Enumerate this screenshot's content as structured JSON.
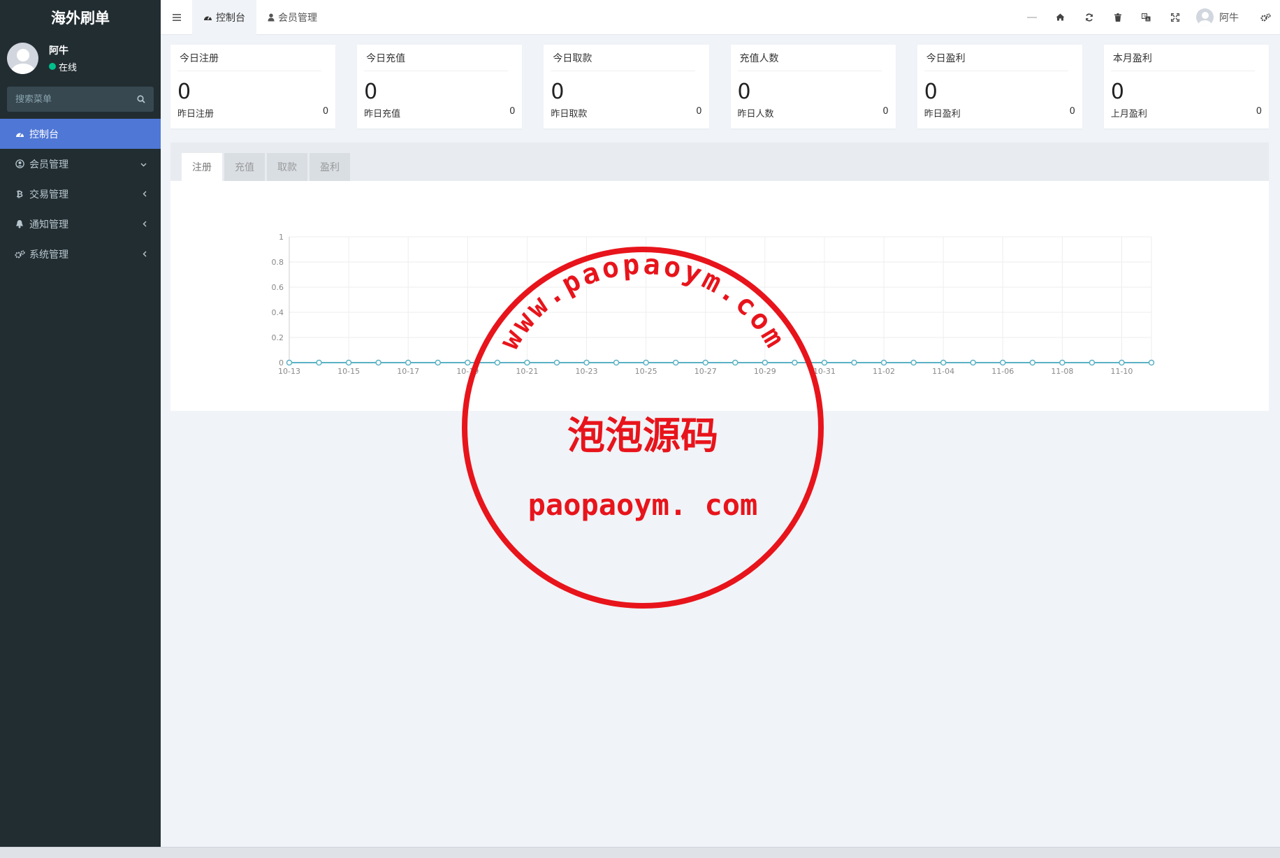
{
  "sidebar": {
    "brand": "海外刷单",
    "user": {
      "name": "阿牛",
      "status": "在线"
    },
    "search": {
      "placeholder": "搜索菜单"
    },
    "items": [
      {
        "label": "控制台",
        "icon": "dashboard-icon",
        "active": true
      },
      {
        "label": "会员管理",
        "icon": "user-circle-icon",
        "caret": "chevron-down-icon"
      },
      {
        "label": "交易管理",
        "icon": "bitcoin-icon",
        "caret": "chevron-left-icon"
      },
      {
        "label": "通知管理",
        "icon": "bell-icon",
        "caret": "chevron-left-icon"
      },
      {
        "label": "系统管理",
        "icon": "cogs-icon",
        "caret": "chevron-left-icon"
      }
    ]
  },
  "header": {
    "tabs": [
      {
        "label": "控制台",
        "icon": "dashboard-icon",
        "active": true
      },
      {
        "label": "会员管理",
        "icon": "user-icon"
      }
    ],
    "user_name": "阿牛"
  },
  "cards": [
    {
      "title": "今日注册",
      "value": "0",
      "sub_label": "昨日注册",
      "sub_value": "0"
    },
    {
      "title": "今日充值",
      "value": "0",
      "sub_label": "昨日充值",
      "sub_value": "0"
    },
    {
      "title": "今日取款",
      "value": "0",
      "sub_label": "昨日取款",
      "sub_value": "0"
    },
    {
      "title": "充值人数",
      "value": "0",
      "sub_label": "昨日人数",
      "sub_value": "0"
    },
    {
      "title": "今日盈利",
      "value": "0",
      "sub_label": "昨日盈利",
      "sub_value": "0"
    },
    {
      "title": "本月盈利",
      "value": "0",
      "sub_label": "上月盈利",
      "sub_value": "0"
    }
  ],
  "chart_tabs": [
    "注册",
    "充值",
    "取款",
    "盈利"
  ],
  "chart_data": {
    "type": "line",
    "x": [
      "10-13",
      "10-14",
      "10-15",
      "10-16",
      "10-17",
      "10-18",
      "10-19",
      "10-20",
      "10-21",
      "10-22",
      "10-23",
      "10-24",
      "10-25",
      "10-26",
      "10-27",
      "10-28",
      "10-29",
      "10-30",
      "10-31",
      "11-01",
      "11-02",
      "11-03",
      "11-04",
      "11-05",
      "11-06",
      "11-07",
      "11-08",
      "11-09",
      "11-10",
      "11-11"
    ],
    "x_tick_labels": [
      "10-13",
      "10-15",
      "10-17",
      "10-19",
      "10-21",
      "10-23",
      "10-25",
      "10-27",
      "10-29",
      "10-31",
      "11-02",
      "11-04",
      "11-06",
      "11-08",
      "11-10"
    ],
    "series": [
      {
        "values": [
          0,
          0,
          0,
          0,
          0,
          0,
          0,
          0,
          0,
          0,
          0,
          0,
          0,
          0,
          0,
          0,
          0,
          0,
          0,
          0,
          0,
          0,
          0,
          0,
          0,
          0,
          0,
          0,
          0,
          0
        ]
      }
    ],
    "y_ticks": [
      "0",
      "0.2",
      "0.4",
      "0.6",
      "0.8",
      "1"
    ],
    "ylim": [
      0,
      1
    ],
    "grid": true,
    "line_color": "#5ab1c4"
  },
  "watermark": {
    "arc_text": "www.paopaoym.com",
    "name": "泡泡源码",
    "domain": "paopaoym. com",
    "color": "#e8141b"
  }
}
